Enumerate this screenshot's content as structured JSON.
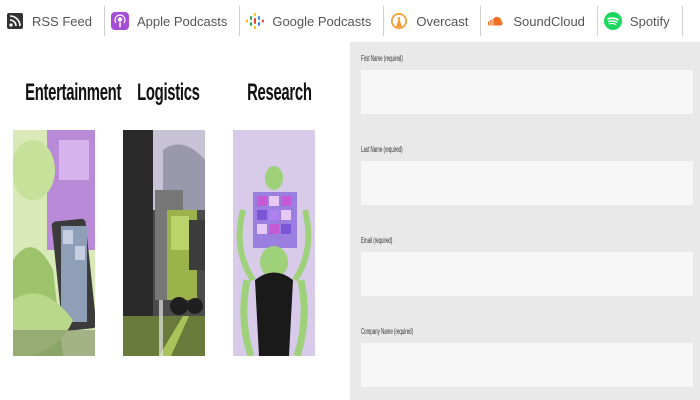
{
  "podcast_links": [
    {
      "label": "RSS Feed",
      "icon": "rss-icon",
      "color": "#333333"
    },
    {
      "label": "Apple Podcasts",
      "icon": "apple-podcasts-icon",
      "color": "#a64dd8"
    },
    {
      "label": "Google Podcasts",
      "icon": "google-podcasts-icon",
      "color": "#4285f4"
    },
    {
      "label": "Overcast",
      "icon": "overcast-icon",
      "color": "#f39a32"
    },
    {
      "label": "SoundCloud",
      "icon": "soundcloud-icon",
      "color": "#f26f23"
    },
    {
      "label": "Spotify",
      "icon": "spotify-icon",
      "color": "#1ed760"
    }
  ],
  "categories": [
    {
      "title": "Entertainment"
    },
    {
      "title": "Logistics"
    },
    {
      "title": "Research"
    }
  ],
  "form": {
    "first_name_label": "First Name (required)",
    "first_name_value": "",
    "last_name_label": "Last Name (required)",
    "last_name_value": "",
    "email_label": "Email (required)",
    "email_value": "",
    "company_label": "Company Name (required)",
    "company_value": ""
  }
}
